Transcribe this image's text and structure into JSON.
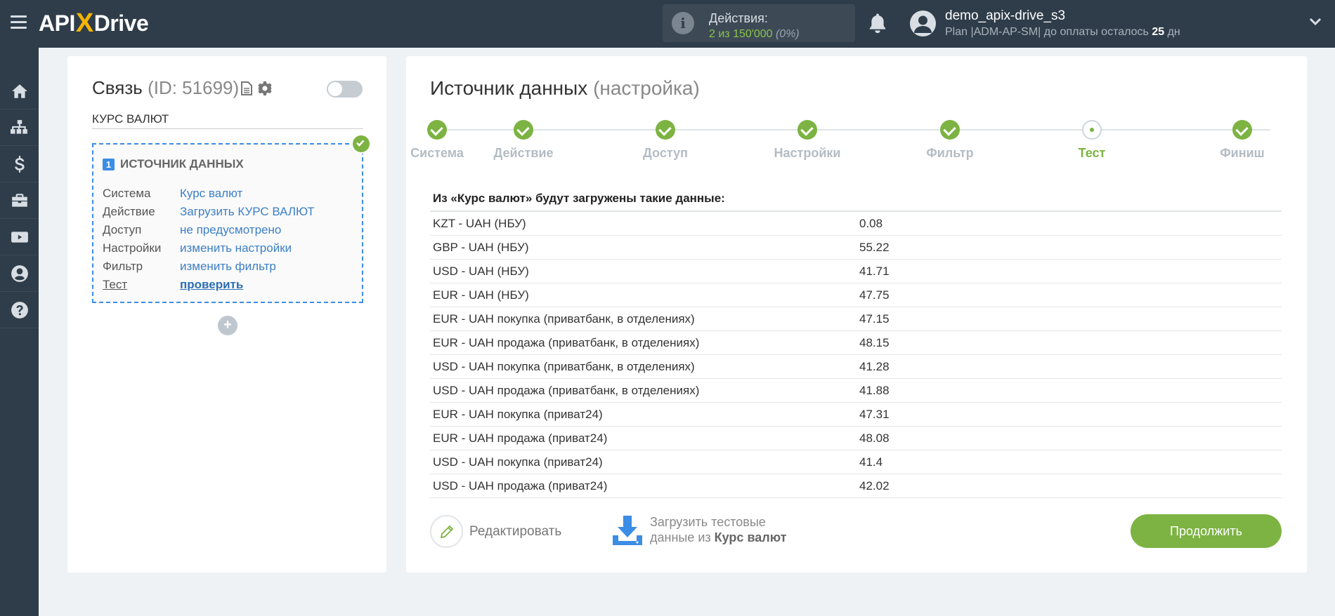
{
  "header": {
    "logo_left": "API",
    "logo_x": "X",
    "logo_right": "Drive",
    "actions_label": "Действия:",
    "actions_value": "2 из 150'000",
    "actions_pct": "(0%)",
    "user_name": "demo_apix-drive_s3",
    "plan_prefix": "Plan |ADM-AP-SM| до оплаты осталось",
    "plan_days": "25",
    "plan_suffix": "дн"
  },
  "sidebar": {
    "items": [
      {
        "name": "home-icon"
      },
      {
        "name": "sitemap-icon"
      },
      {
        "name": "dollar-icon"
      },
      {
        "name": "briefcase-icon"
      },
      {
        "name": "youtube-icon"
      },
      {
        "name": "user-icon"
      },
      {
        "name": "question-icon"
      }
    ]
  },
  "connection": {
    "title": "Связь",
    "id_text": "(ID: 51699)",
    "name": "КУРС ВАЛЮТ",
    "source": {
      "number": "1",
      "heading": "ИСТОЧНИК ДАННЫХ",
      "rows": [
        {
          "key": "Система",
          "value": "Курс валют"
        },
        {
          "key": "Действие",
          "value": "Загрузить КУРС ВАЛЮТ"
        },
        {
          "key": "Доступ",
          "value": "не предусмотрено"
        },
        {
          "key": "Настройки",
          "value": "изменить настройки"
        },
        {
          "key": "Фильтр",
          "value": "изменить фильтр"
        },
        {
          "key": "Тест",
          "value": "проверить"
        }
      ]
    },
    "add_symbol": "+"
  },
  "main": {
    "title": "Источник данных",
    "subtitle": "(настройка)",
    "steps": [
      {
        "label": "Система",
        "state": "done"
      },
      {
        "label": "Действие",
        "state": "done"
      },
      {
        "label": "Доступ",
        "state": "done"
      },
      {
        "label": "Настройки",
        "state": "done"
      },
      {
        "label": "Фильтр",
        "state": "done"
      },
      {
        "label": "Тест",
        "state": "current"
      },
      {
        "label": "Финиш",
        "state": "done"
      }
    ],
    "table_heading": "Из «Курс валют» будут загружены такие данные:",
    "rows": [
      {
        "name": "KZT - UAH (НБУ)",
        "value": "0.08"
      },
      {
        "name": "GBP - UAH (НБУ)",
        "value": "55.22"
      },
      {
        "name": "USD - UAH (НБУ)",
        "value": "41.71"
      },
      {
        "name": "EUR - UAH (НБУ)",
        "value": "47.75"
      },
      {
        "name": "EUR - UAH покупка (приватбанк, в отделениях)",
        "value": "47.15"
      },
      {
        "name": "EUR - UAH продажа (приватбанк, в отделениях)",
        "value": "48.15"
      },
      {
        "name": "USD - UAH покупка (приватбанк, в отделениях)",
        "value": "41.28"
      },
      {
        "name": "USD - UAH продажа (приватбанк, в отделениях)",
        "value": "41.88"
      },
      {
        "name": "EUR - UAH покупка (приват24)",
        "value": "47.31"
      },
      {
        "name": "EUR - UAH продажа (приват24)",
        "value": "48.08"
      },
      {
        "name": "USD - UAH покупка (приват24)",
        "value": "41.4"
      },
      {
        "name": "USD - UAH продажа (приват24)",
        "value": "42.02"
      }
    ],
    "edit_label": "Редактировать",
    "load_line1": "Загрузить тестовые",
    "load_line2_prefix": "данные из",
    "load_line2_bold": "Курс валют",
    "continue_label": "Продолжить"
  },
  "colors": {
    "topbar": "#2f3d4a",
    "accent_green": "#7cb342",
    "link_blue": "#3c7fc6",
    "dashed_border": "#3c8de5"
  }
}
